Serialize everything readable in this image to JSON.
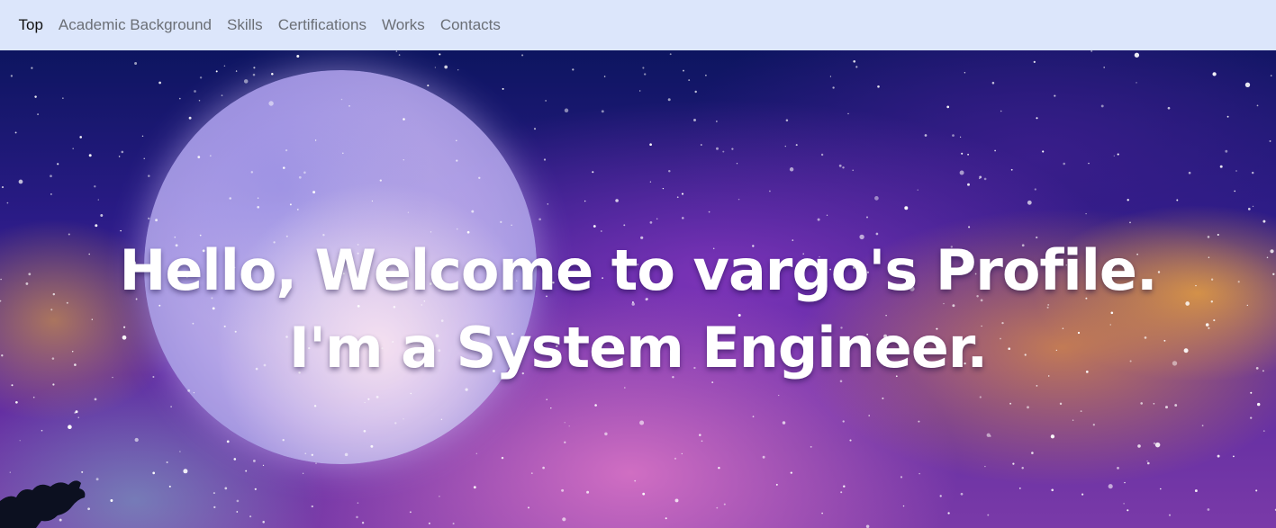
{
  "nav": {
    "items": [
      {
        "label": "Top",
        "active": true
      },
      {
        "label": "Academic Background",
        "active": false
      },
      {
        "label": "Skills",
        "active": false
      },
      {
        "label": "Certifications",
        "active": false
      },
      {
        "label": "Works",
        "active": false
      },
      {
        "label": "Contacts",
        "active": false
      }
    ]
  },
  "hero": {
    "line1": "Hello, Welcome to vargo's Profile.",
    "line2": "I'm a System Engineer."
  },
  "colors": {
    "navbar_bg": "#dce6fb",
    "nav_text": "#6b6f76",
    "nav_active": "#111111",
    "hero_text": "#ffffff"
  }
}
